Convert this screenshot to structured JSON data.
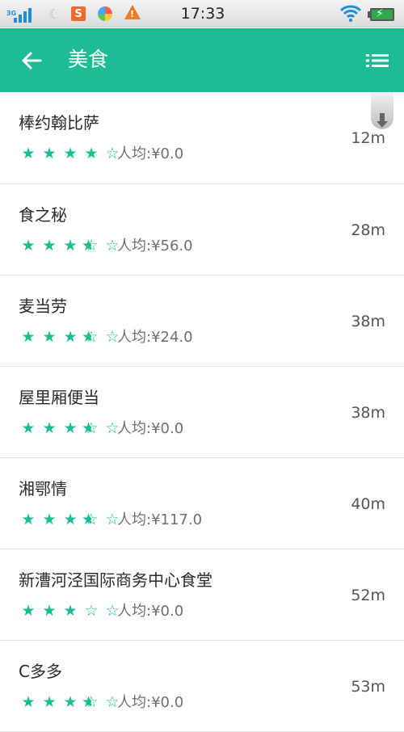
{
  "status_bar": {
    "network": "3G",
    "time": "17:33",
    "sogou_label": "S"
  },
  "header": {
    "title": "美食",
    "back_icon": "arrow-left-icon",
    "menu_icon": "list-menu-icon"
  },
  "colors": {
    "accent": "#1cbc95",
    "text": "#2a2a2a",
    "muted": "#6f6f6f"
  },
  "restaurants": [
    {
      "name": "棒约翰比萨",
      "rating": 4.0,
      "price": "人均:¥0.0",
      "distance": "12m"
    },
    {
      "name": "食之秘",
      "rating": 3.5,
      "price": "人均:¥56.0",
      "distance": "28m"
    },
    {
      "name": "麦当劳",
      "rating": 3.5,
      "price": "人均:¥24.0",
      "distance": "38m"
    },
    {
      "name": "屋里厢便当",
      "rating": 3.5,
      "price": "人均:¥0.0",
      "distance": "38m"
    },
    {
      "name": "湘鄂情",
      "rating": 3.5,
      "price": "人均:¥117.0",
      "distance": "40m"
    },
    {
      "name": "新漕河泾国际商务中心食堂",
      "rating": 3.0,
      "price": "人均:¥0.0",
      "distance": "52m"
    },
    {
      "name": "C多多",
      "rating": 3.5,
      "price": "人均:¥0.0",
      "distance": "53m"
    }
  ]
}
